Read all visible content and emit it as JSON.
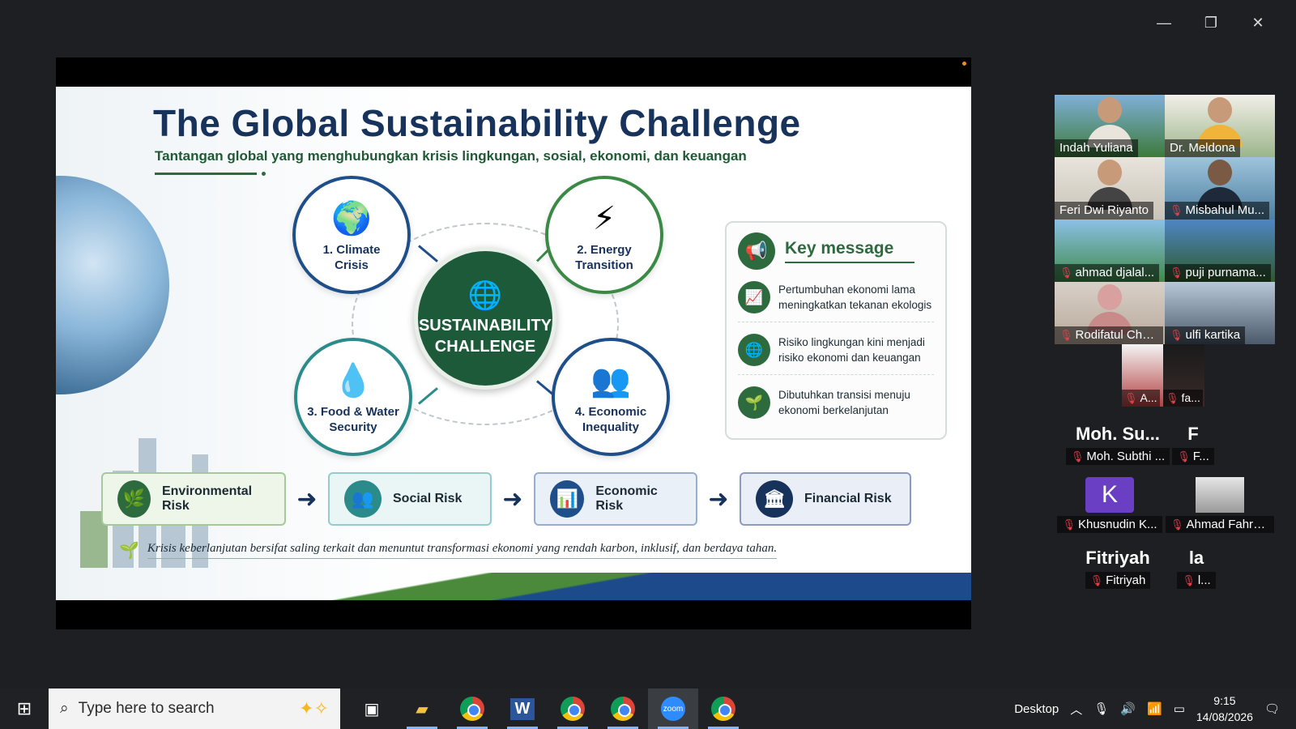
{
  "window": {
    "minimize": "—",
    "restore": "❐",
    "close": "✕"
  },
  "slide": {
    "title": "The Global Sustainability Challenge",
    "subtitle": "Tantangan global yang menghubungkan krisis lingkungan, sosial, ekonomi, dan keuangan",
    "nodes": [
      {
        "label": "1. Climate\nCrisis",
        "icon": "climate-icon"
      },
      {
        "label": "2. Energy\nTransition",
        "icon": "energy-icon"
      },
      {
        "label": "3. Food & Water\nSecurity",
        "icon": "water-icon"
      },
      {
        "label": "4. Economic\nInequality",
        "icon": "people-icon"
      }
    ],
    "center": "SUSTAINABILITY\nCHALLENGE",
    "key_message": {
      "title": "Key message",
      "items": [
        "Pertumbuhan ekonomi lama meningkatkan tekanan ekologis",
        "Risiko lingkungan kini menjadi risiko ekonomi dan keuangan",
        "Dibutuhkan transisi menuju ekonomi berkelanjutan"
      ]
    },
    "risks": [
      "Environmental Risk",
      "Social Risk",
      "Economic Risk",
      "Financial Risk"
    ],
    "footnote": "Krisis keberlanjutan bersifat saling terkait dan menuntut transformasi ekonomi yang rendah karbon, inklusif, dan berdaya tahan."
  },
  "participants": {
    "video": [
      "Indah Yuliana",
      "Dr. Meldona",
      "Feri Dwi Riyanto",
      "Misbahul Mu...",
      "ahmad djalal...",
      "puji purnama...",
      "Rodifatul Cha...",
      "ulfi kartika"
    ],
    "small": [
      "A...",
      "fa..."
    ],
    "letters": [
      {
        "big": "Moh. Su...",
        "name": "Moh. Subthi ..."
      },
      {
        "big": "F",
        "name": "F..."
      },
      {
        "big": "K",
        "name": "Khusnudin K..."
      },
      {
        "big": "",
        "name": "Ahmad Fahru..."
      },
      {
        "big": "Fitriyah",
        "name": "Fitriyah"
      },
      {
        "big": "la",
        "name": "l..."
      }
    ]
  },
  "taskbar": {
    "search_placeholder": "Type here to search",
    "desktop_label": "Desktop",
    "time": "9:15",
    "date": "14/08/2026"
  },
  "colors": {
    "navy": "#17325b",
    "green": "#2d6b3f",
    "teal": "#2a8b8a",
    "active": "#23d160"
  }
}
